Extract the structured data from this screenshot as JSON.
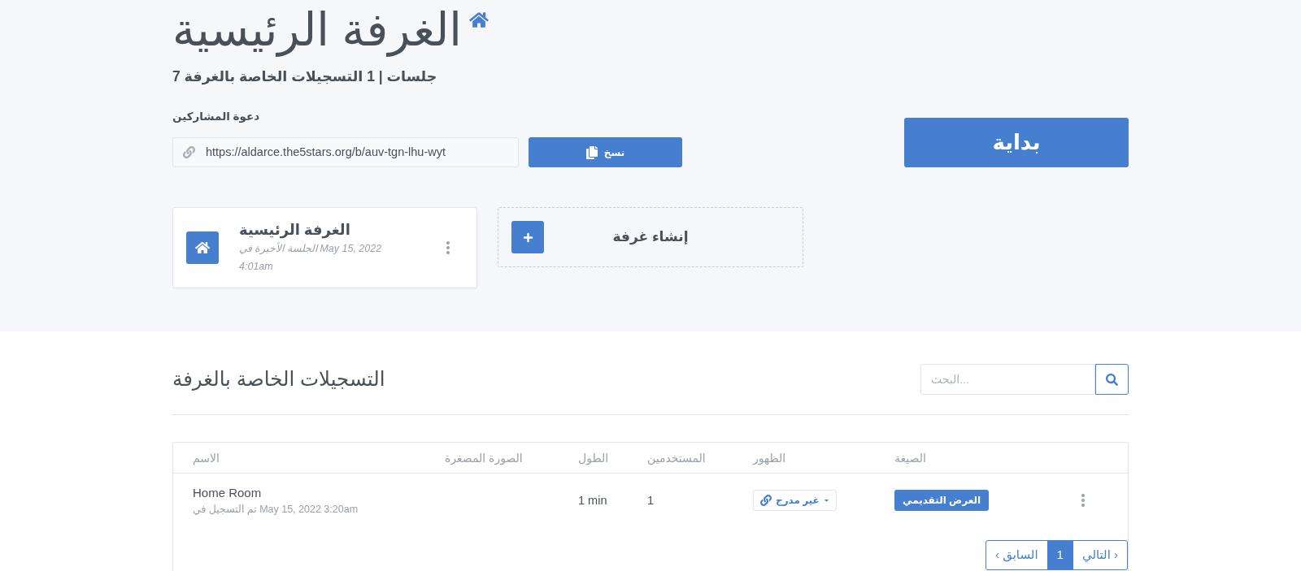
{
  "header": {
    "title": "الغرفة الرئيسية",
    "subtitle": "7 جلسات | 1 التسجيلات الخاصة بالغرفة"
  },
  "invite": {
    "label": "دعوة المشاركين",
    "url": "https://aldarce.the5stars.org/b/auv-tgn-lhu-wyt",
    "copy_button": "نسخ"
  },
  "start_button": "بداية",
  "rooms": [
    {
      "kind": "room",
      "name": "الغرفة الرئيسية",
      "last_session": "الجلسة الأخيرة في May 15, 2022 4:01am"
    },
    {
      "kind": "create",
      "label": "إنشاء غرفة"
    }
  ],
  "recordings": {
    "title": "التسجيلات الخاصة بالغرفة",
    "search": {
      "placeholder": "البحث..."
    },
    "columns": [
      "الصيغة",
      "الظهور",
      "المستخدمين",
      "الطول",
      "الصورة المصغرة",
      "الاسم"
    ],
    "rows": [
      {
        "name": "Home Room",
        "recorded": "تم التسجيل في May 15, 2022 3:20am",
        "length": "1 min",
        "users": "1",
        "visibility": "غير مدرج",
        "format": "العرض التقديمي"
      }
    ],
    "pagination": [
      {
        "label": "التالي ›",
        "selected": false
      },
      {
        "label": "1",
        "selected": true
      },
      {
        "label": "‹ السابق",
        "selected": false
      }
    ]
  }
}
